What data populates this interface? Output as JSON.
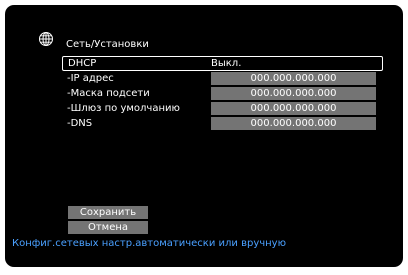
{
  "header": {
    "icon": "globe-icon",
    "title": "Сеть/Установки"
  },
  "settings": [
    {
      "label": "DHCP",
      "value": "Выкл.",
      "selected": true
    },
    {
      "label": "-IP адрес",
      "value": "000.000.000.000"
    },
    {
      "label": "-Маска подсети",
      "value": "000.000.000.000"
    },
    {
      "label": "-Шлюз по умолчанию",
      "value": "000.000.000.000"
    },
    {
      "label": "-DNS",
      "value": "000.000.000.000"
    }
  ],
  "buttons": {
    "save_label": "Сохранить",
    "cancel_label": "Отмена"
  },
  "hint": "Конфиг.сетевых настр.автоматически или вручную",
  "colors": {
    "background": "#000000",
    "field": "#747474",
    "hint": "#4aa0ff",
    "text": "#ffffff"
  }
}
